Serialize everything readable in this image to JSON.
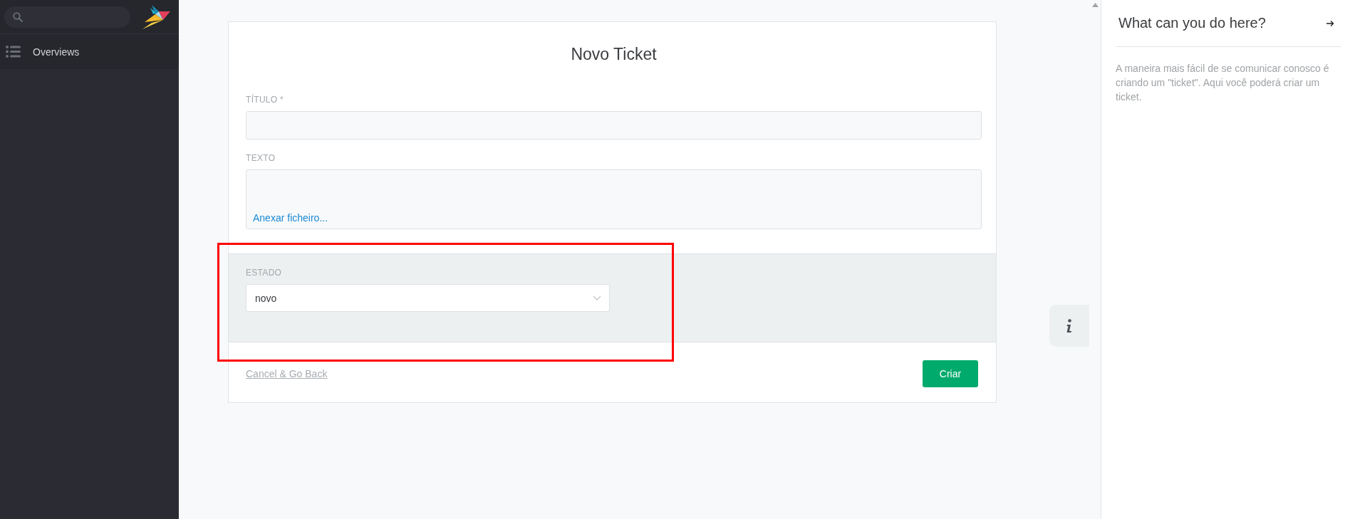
{
  "sidebar": {
    "search": {
      "kind": "search"
    },
    "items": [
      {
        "label": "Overviews"
      }
    ]
  },
  "form": {
    "title": "Novo Ticket",
    "fields": [
      {
        "kind": "input",
        "label": "TÍTULO *"
      },
      {
        "kind": "textarea",
        "label": "TEXTO",
        "link": "Anexar ficheiro..."
      }
    ],
    "attributes": [
      {
        "kind": "select",
        "label": "ESTADO",
        "value": "novo"
      }
    ],
    "cancel": "Cancel & Go Back",
    "submit": "Criar"
  },
  "help_panel": {
    "title": "What can you do here?",
    "body": "A maneira mais fácil de se comunicar conosco é criando um \"ticket\". Aqui você poderá criar um ticket."
  }
}
